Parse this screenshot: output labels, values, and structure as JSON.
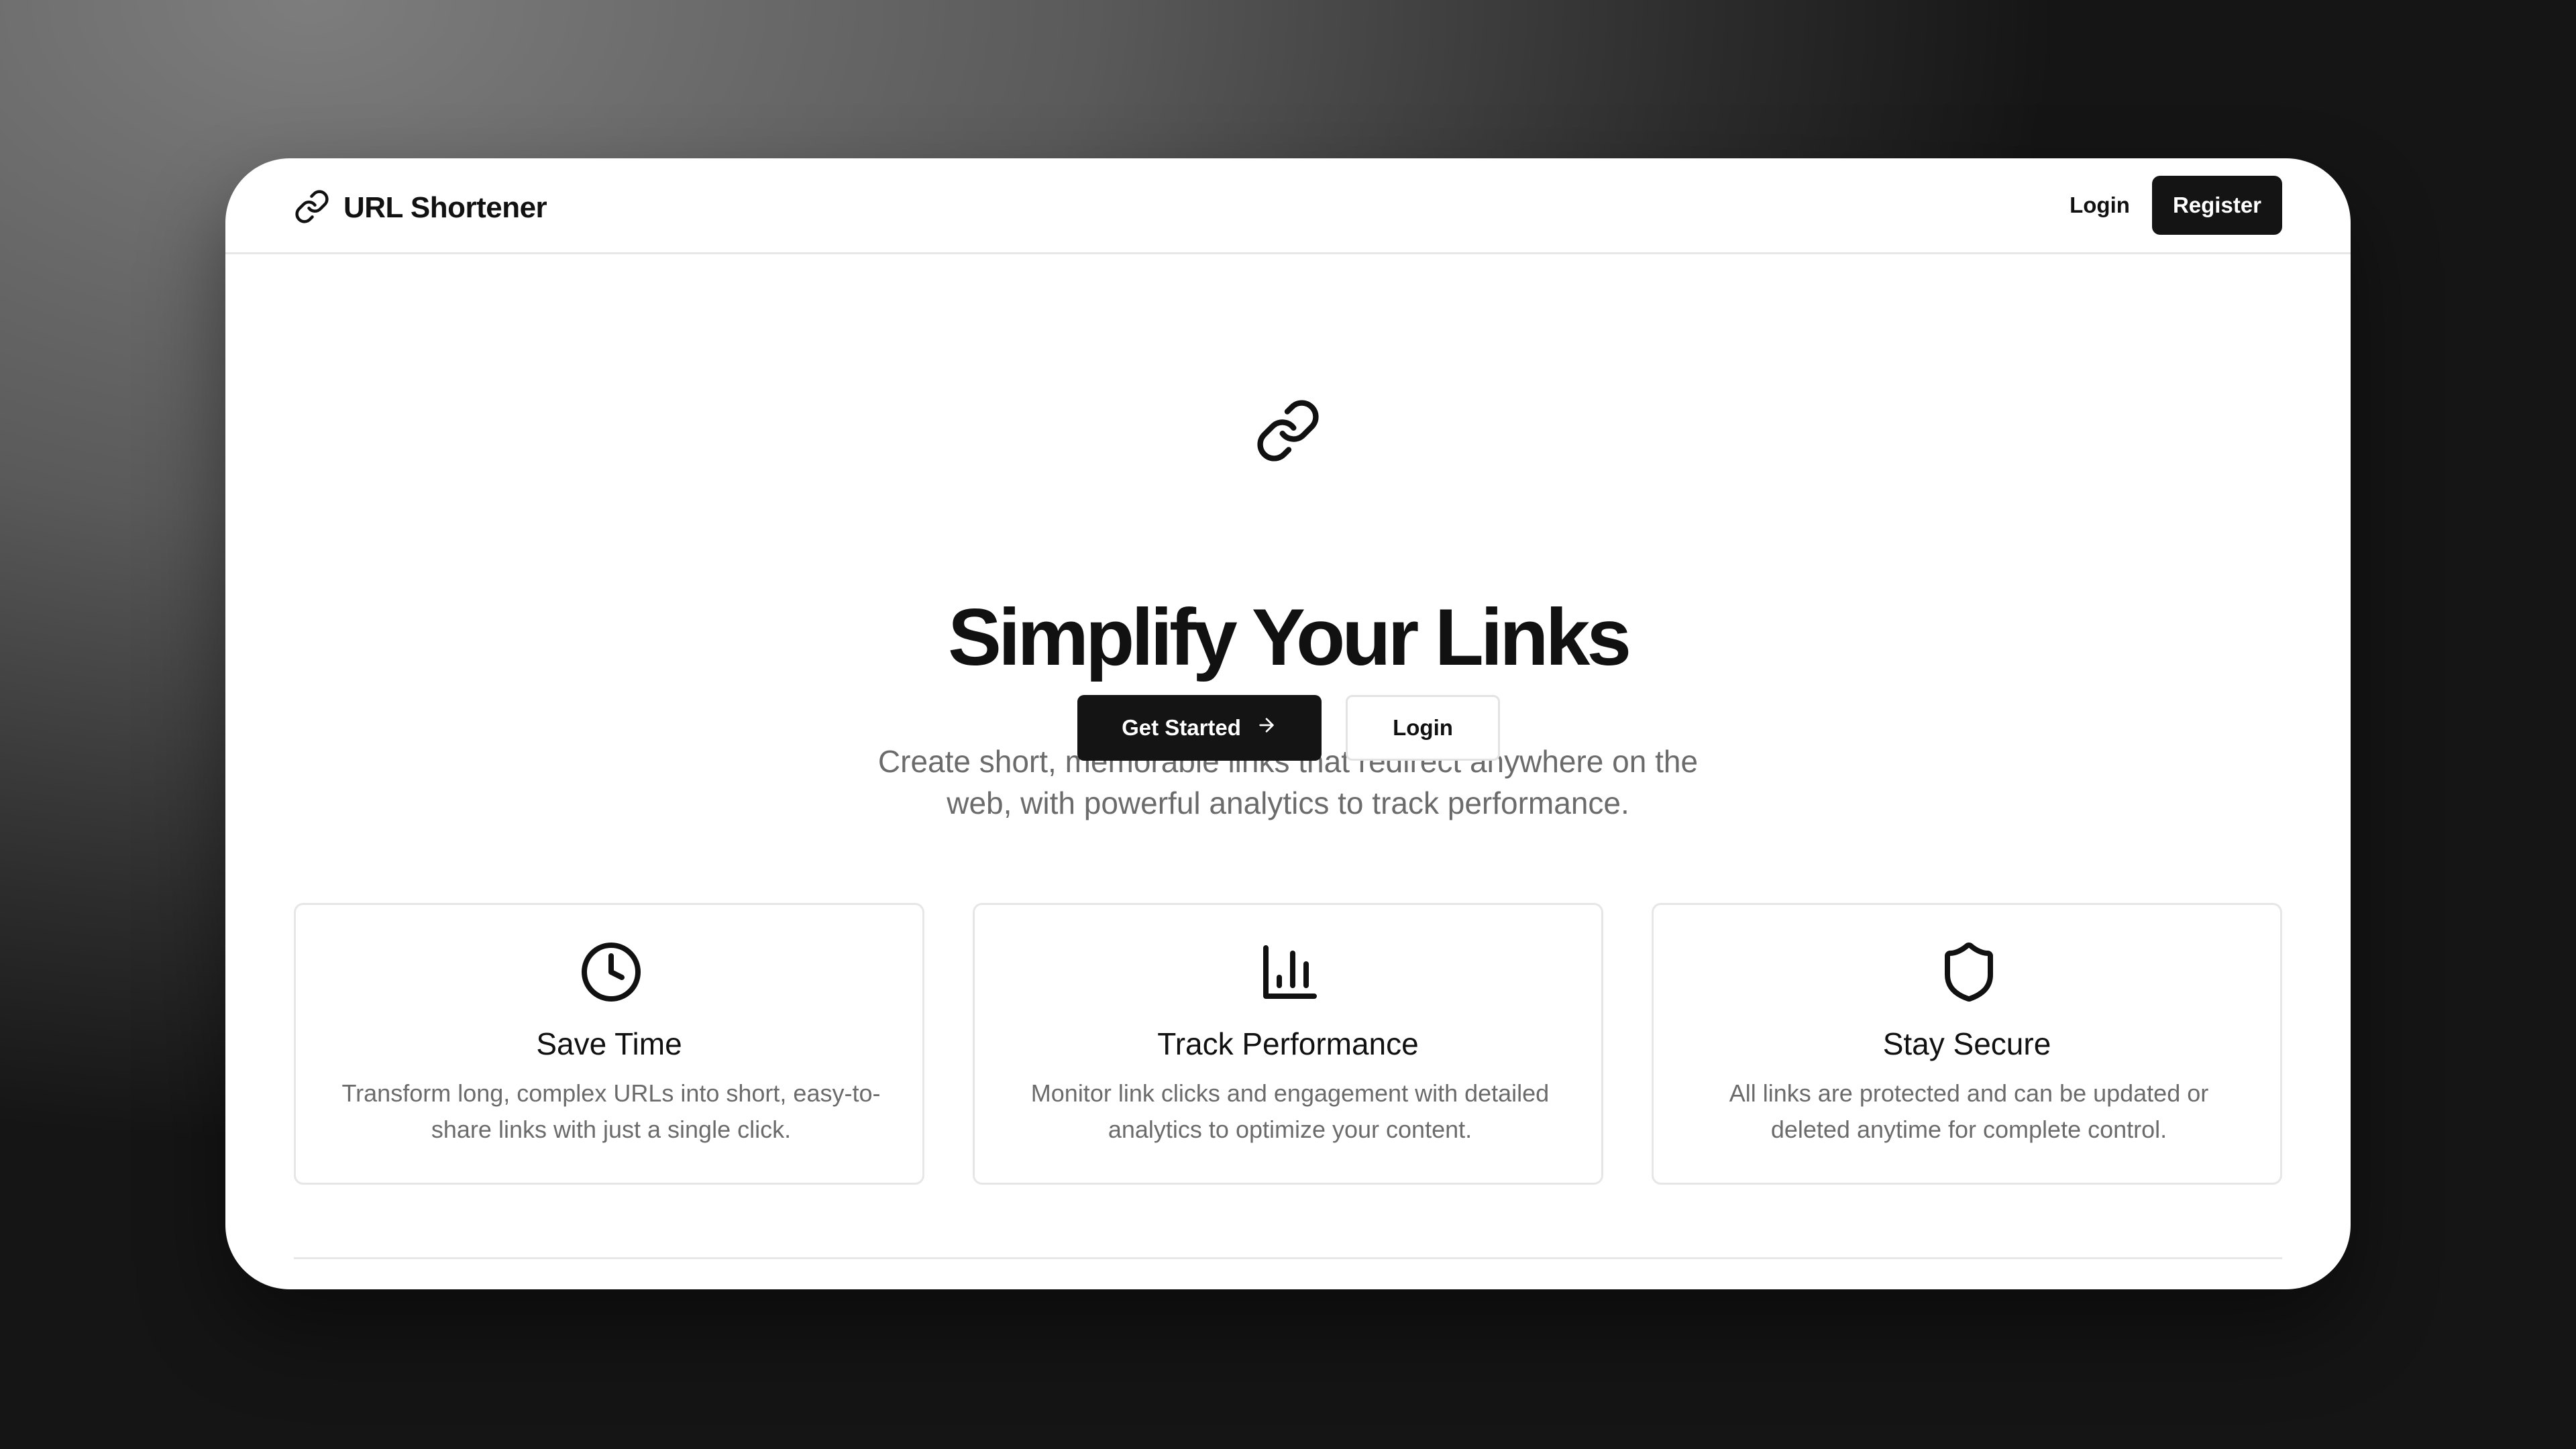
{
  "header": {
    "brand_name": "URL Shortener",
    "brand_icon": "link-icon",
    "login_label": "Login",
    "register_label": "Register"
  },
  "hero": {
    "icon": "link-icon",
    "title": "Simplify Your Links",
    "subtitle": "Create short, memorable links that redirect anywhere on the web, with powerful analytics to track performance.",
    "primary_label": "Get Started",
    "primary_icon": "arrow-right-icon",
    "secondary_label": "Login"
  },
  "features": [
    {
      "icon": "clock-icon",
      "title": "Save Time",
      "description": "Transform long, complex URLs into short, easy-to-share links with just a single click."
    },
    {
      "icon": "bar-chart-icon",
      "title": "Track Performance",
      "description": "Monitor link clicks and engagement with detailed analytics to optimize your content."
    },
    {
      "icon": "shield-icon",
      "title": "Stay Secure",
      "description": "All links are protected and can be updated or deleted anytime for complete control."
    }
  ],
  "colors": {
    "primary": "#141414",
    "text": "#111111",
    "muted": "#6b6b6b",
    "border": "#e6e6e6"
  }
}
